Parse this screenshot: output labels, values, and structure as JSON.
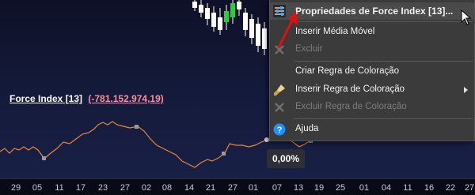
{
  "indicator": {
    "name": "Force Index [13]",
    "value": "(-781.152.974,19)"
  },
  "percent_bubble": "0,00%",
  "x_axis_ticks": [
    "29",
    "05",
    "11",
    "17",
    "23",
    "27",
    "02",
    "08",
    "14",
    "21",
    "27",
    "01",
    "07",
    "13",
    "19",
    "25",
    "01",
    "04",
    "11",
    "16",
    "22",
    "27"
  ],
  "menu": {
    "items": [
      {
        "label": "Propriedades de Force Index [13]...",
        "icon": "properties-icon",
        "enabled": true
      },
      {
        "label": "Inserir Média Móvel",
        "icon": "",
        "enabled": true
      },
      {
        "label": "Excluir",
        "icon": "delete-icon",
        "enabled": false
      },
      {
        "label": "Criar Regra de Coloração",
        "icon": "",
        "enabled": true
      },
      {
        "label": "Inserir Regra de Coloração",
        "icon": "brush-icon",
        "enabled": true
      },
      {
        "label": "Excluir Regra de Coloração",
        "icon": "delete-icon",
        "enabled": false
      },
      {
        "label": "Ajuda",
        "icon": "help-icon",
        "enabled": true
      }
    ]
  },
  "colors": {
    "background": "#141a3a",
    "line": "#e8863a",
    "menu_bg": "#3b3b3b",
    "help_blue": "#1e90ff",
    "arrow_red": "#e01010"
  }
}
